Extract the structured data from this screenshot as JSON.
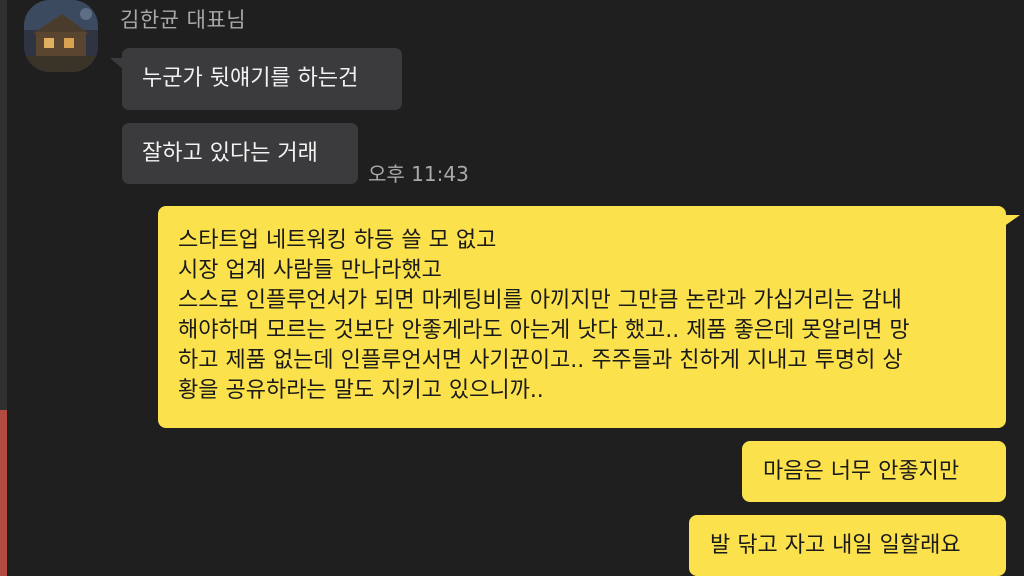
{
  "chat": {
    "sender": {
      "name": "김한균 대표님"
    },
    "received": [
      {
        "text": "누군가 뒷얘기를 하는건"
      },
      {
        "text": "잘하고 있다는 거래"
      }
    ],
    "received_time": "오후 11:43",
    "sent": [
      {
        "lines": [
          "스타트업 네트워킹 하등 쓸 모 없고",
          "시장 업계 사람들 만나라했고",
          "스스로 인플루언서가 되면 마케팅비를 아끼지만 그만큼 논란과 가십거리는 감내",
          "해야하며 모르는 것보단 안좋게라도 아는게 낫다 했고.. 제품 좋은데 못알리면 망",
          "하고 제품 없는데 인플루언서면 사기꾼이고.. 주주들과 친하게 지내고 투명히 상",
          "황을 공유하라는 말도 지키고 있으니까.."
        ]
      },
      {
        "text": "마음은 너무 안좋지만"
      },
      {
        "text": "발 닦고 자고 내일 일할래요"
      }
    ]
  },
  "colors": {
    "background": "#1f1f20",
    "received_bubble": "#3b3b3d",
    "sent_bubble": "#fbe14c",
    "muted_text": "#a8a8a8"
  }
}
